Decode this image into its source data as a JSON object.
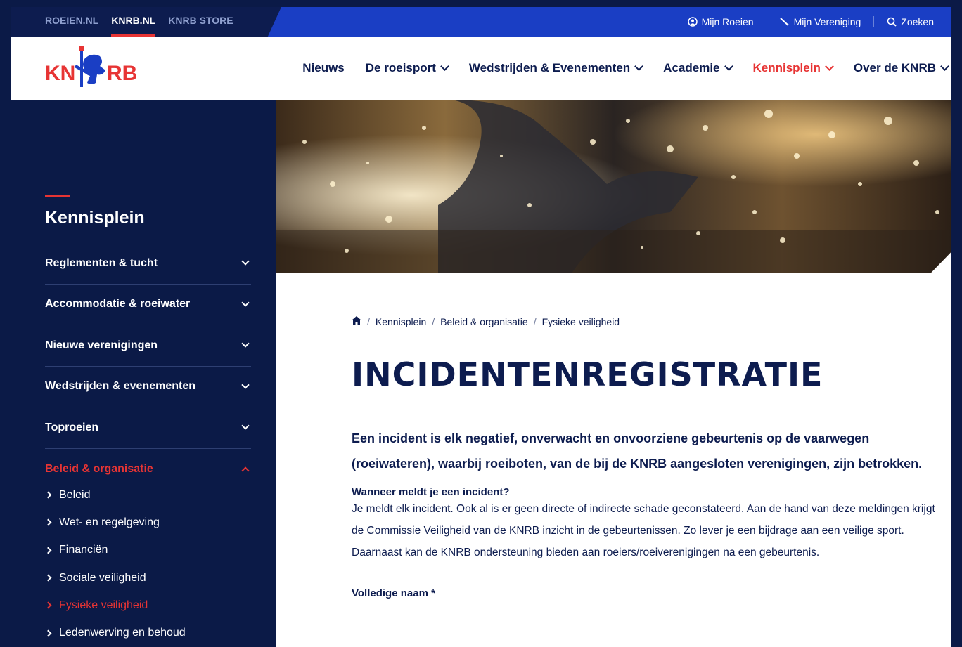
{
  "topbar": {
    "links": [
      {
        "label": "ROEIEN.NL",
        "active": false
      },
      {
        "label": "KNRB.NL",
        "active": true
      },
      {
        "label": "KNRB STORE",
        "active": false
      }
    ],
    "utility": [
      {
        "label": "Mijn Roeien",
        "icon": "user-circle-icon"
      },
      {
        "label": "Mijn Vereniging",
        "icon": "oar-icon"
      },
      {
        "label": "Zoeken",
        "icon": "search-icon"
      }
    ]
  },
  "logo": {
    "left": "KN",
    "right": "RB"
  },
  "nav": [
    {
      "label": "Nieuws",
      "dropdown": false,
      "active": false
    },
    {
      "label": "De roeisport",
      "dropdown": true,
      "active": false
    },
    {
      "label": "Wedstrijden & Evenementen",
      "dropdown": true,
      "active": false
    },
    {
      "label": "Academie",
      "dropdown": true,
      "active": false
    },
    {
      "label": "Kennisplein",
      "dropdown": true,
      "active": true
    },
    {
      "label": "Over de KNRB",
      "dropdown": true,
      "active": false
    }
  ],
  "sidebar": {
    "title": "Kennisplein",
    "items": [
      {
        "label": "Reglementen & tucht",
        "open": false
      },
      {
        "label": "Accommodatie & roeiwater",
        "open": false
      },
      {
        "label": "Nieuwe verenigingen",
        "open": false
      },
      {
        "label": "Wedstrijden & evenementen",
        "open": false
      },
      {
        "label": "Toproeien",
        "open": false
      },
      {
        "label": "Beleid & organisatie",
        "open": true
      }
    ],
    "subitems": [
      {
        "label": "Beleid",
        "active": false
      },
      {
        "label": "Wet- en regelgeving",
        "active": false
      },
      {
        "label": "Financiën",
        "active": false
      },
      {
        "label": "Sociale veiligheid",
        "active": false
      },
      {
        "label": "Fysieke veiligheid",
        "active": true
      },
      {
        "label": "Ledenwerving en behoud",
        "active": false
      }
    ]
  },
  "breadcrumb": [
    "Kennisplein",
    "Beleid & organisatie",
    "Fysieke veiligheid"
  ],
  "page": {
    "title": "INCIDENTENREGISTRATIE",
    "lead": "Een incident is elk negatief, onverwacht en onvoorziene gebeurtenis op de vaarwegen (roeiwateren), waarbij roeiboten, van de bij de KNRB aangesloten verenigingen, zijn betrokken.",
    "question": "Wanneer meldt je een incident?",
    "body": "Je meldt elk incident. Ook al is er geen directe of indirecte schade geconstateerd. Aan de hand van deze meldingen krijgt de Commissie Veiligheid van de KNRB inzicht in de gebeurtenissen. Zo lever je een bijdrage aan een veilige sport. Daarnaast kan de KNRB ondersteuning bieden aan roeiers/roeiverenigingen na een gebeurtenis.",
    "field_label": "Volledige naam *"
  },
  "colors": {
    "navy": "#0b1a47",
    "blue": "#1a3ec4",
    "red": "#e73434"
  }
}
